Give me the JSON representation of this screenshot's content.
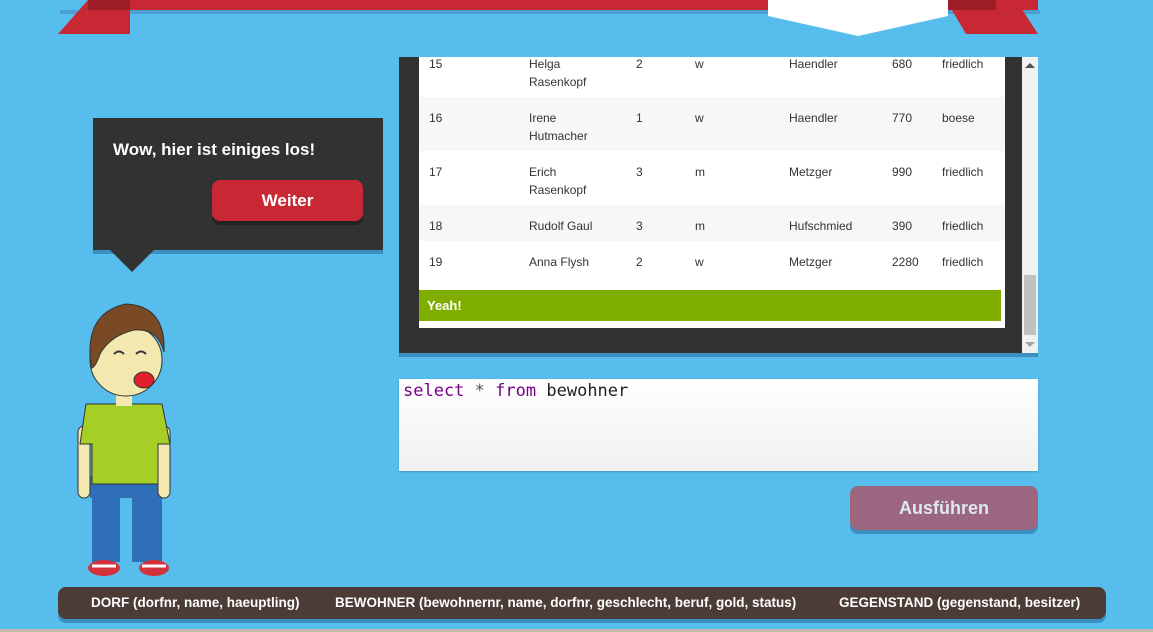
{
  "bubble": {
    "text": "Wow, hier ist einiges los!",
    "button_label": "Weiter"
  },
  "table": {
    "rows": [
      {
        "nr": "15",
        "name": "Helga\nRasenkopf",
        "dorfnr": "2",
        "geschlecht": "w",
        "beruf": "Haendler",
        "gold": "680",
        "status": "friedlich"
      },
      {
        "nr": "16",
        "name": "Irene\nHutmacher",
        "dorfnr": "1",
        "geschlecht": "w",
        "beruf": "Haendler",
        "gold": "770",
        "status": "boese"
      },
      {
        "nr": "17",
        "name": "Erich\nRasenkopf",
        "dorfnr": "3",
        "geschlecht": "m",
        "beruf": "Metzger",
        "gold": "990",
        "status": "friedlich"
      },
      {
        "nr": "18",
        "name": "Rudolf Gaul",
        "dorfnr": "3",
        "geschlecht": "m",
        "beruf": "Hufschmied",
        "gold": "390",
        "status": "friedlich"
      },
      {
        "nr": "19",
        "name": "Anna Flysh",
        "dorfnr": "2",
        "geschlecht": "w",
        "beruf": "Metzger",
        "gold": "2280",
        "status": "friedlich"
      }
    ]
  },
  "result_message": "Yeah!",
  "editor": {
    "keyword_select": "select",
    "operator": "*",
    "keyword_from": "from",
    "table_name": "bewohner"
  },
  "run_button_label": "Ausführen",
  "schema": {
    "dorf": "DORF (dorfnr, name, haeuptling)",
    "bewohner": "BEWOHNER (bewohnernr, name, dorfnr, geschlecht, beruf, gold, status)",
    "gegenstand": "GEGENSTAND (gegenstand, besitzer)"
  },
  "colors": {
    "background": "#56bdec",
    "banner_red": "#c72833",
    "success_green": "#7fad00",
    "run_button": "#9b6780",
    "footer": "#4b3c36"
  }
}
